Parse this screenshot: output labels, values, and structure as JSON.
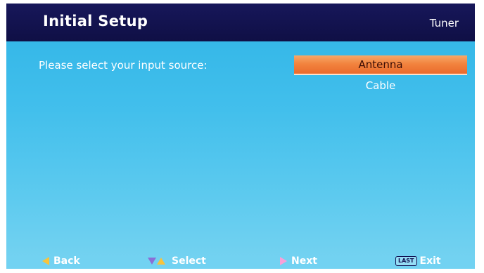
{
  "header": {
    "title": "Initial Setup",
    "section": "Tuner"
  },
  "main": {
    "prompt": "Please select your input source:",
    "options": [
      {
        "label": "Antenna",
        "selected": true
      },
      {
        "label": "Cable",
        "selected": false
      }
    ]
  },
  "footer": {
    "back_label": "Back",
    "select_label": "Select",
    "next_label": "Next",
    "exit_key": "LAST",
    "exit_label": "Exit"
  },
  "colors": {
    "header_bg": "#17175a",
    "screen_bg": "#42bfec",
    "selection_highlight": "#f2843f",
    "back_arrow": "#f7c33c",
    "select_down_arrow": "#8a6fd6",
    "select_up_arrow": "#f7c33c",
    "next_arrow": "#f7a0d8"
  },
  "icons": {
    "back": "triangle-left-icon",
    "select_down": "triangle-down-icon",
    "select_up": "triangle-up-icon",
    "next": "triangle-right-icon",
    "exit": "last-key-icon"
  }
}
